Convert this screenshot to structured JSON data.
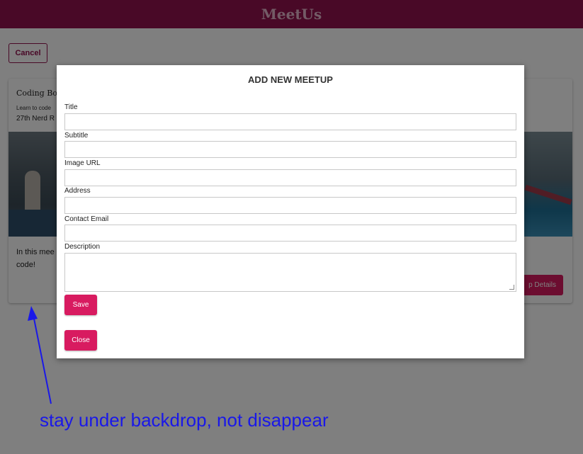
{
  "header": {
    "title": "MeetUs"
  },
  "toolbar": {
    "cancel_label": "Cancel"
  },
  "card": {
    "title": "Coding Boo",
    "subtitle": "Learn to code",
    "address": "27th Nerd R",
    "description": "In this mee code!",
    "details_label": "p Details"
  },
  "modal": {
    "title": "ADD NEW MEETUP",
    "fields": {
      "title_label": "Title",
      "subtitle_label": "Subtitle",
      "image_url_label": "Image URL",
      "address_label": "Address",
      "contact_email_label": "Contact Email",
      "description_label": "Description"
    },
    "save_label": "Save",
    "close_label": "Close"
  },
  "annotation": {
    "text": "stay under backdrop, not disappear",
    "color": "#1a18e8"
  },
  "colors": {
    "brand": "#92124f",
    "accent": "#d81b60"
  }
}
